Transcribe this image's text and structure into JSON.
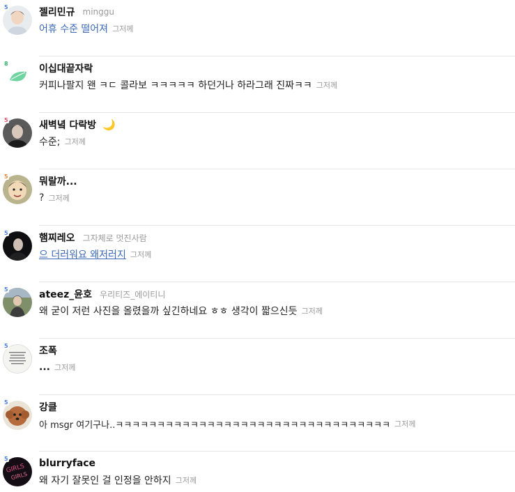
{
  "time_label": "그저께",
  "items": [
    {
      "badge": "5",
      "badge_color": "#4a7fe0",
      "name": "젤리민규",
      "subname": "minggu",
      "message": "어휴 수준 떨어져",
      "message_style": "blue",
      "avatar": "person-light"
    },
    {
      "badge": "8",
      "badge_color": "#2fb36b",
      "name": "이십대끝자락",
      "subname": "",
      "message": "커피나팔지 왠 ㅋㄷ 콜라보 ㅋㅋㅋㅋㅋ 하던거나 하라그래 진짜ㅋㅋ",
      "message_style": "normal",
      "avatar": "leaf"
    },
    {
      "badge": "5",
      "badge_color": "#e0506b",
      "name": "새벽녘 다락방",
      "subname": "",
      "message": "수준;",
      "message_style": "normal",
      "avatar": "person-dark",
      "moon": "🌙"
    },
    {
      "badge": "5",
      "badge_color": "#e08a3b",
      "name": "뭐랄까...",
      "subname": "",
      "message": "?",
      "message_style": "normal",
      "avatar": "child"
    },
    {
      "badge": "5",
      "badge_color": "#4a7fe0",
      "name": "햄찌레오",
      "subname": "그자체로 멋진사람",
      "message": "으 더러워요 왜저러지",
      "message_style": "link",
      "avatar": "person-black"
    },
    {
      "badge": "5",
      "badge_color": "#4a7fe0",
      "name": "ateez_윤호",
      "subname": "우리티즈_에이티니",
      "message": "왜 굳이 저런 사진을 올렸을까 싶긴하네요 ㅎㅎ 생각이 짧으신듯",
      "message_style": "normal",
      "avatar": "person-outdoor"
    },
    {
      "badge": "5",
      "badge_color": "#4a7fe0",
      "name": "조폭",
      "subname": "",
      "message": "...",
      "message_style": "normal",
      "avatar": "text-image"
    },
    {
      "badge": "5",
      "badge_color": "#4a7fe0",
      "name": "강클",
      "subname": "",
      "message": "아 msgr 여기구나..ㅋㅋㅋㅋㅋㅋㅋㅋㅋㅋㅋㅋㅋㅋㅋㅋㅋㅋㅋㅋㅋㅋㅋㅋㅋㅋㅋㅋㅋㅋㅋㅋㅋ",
      "message_style": "normal",
      "avatar": "dog"
    },
    {
      "badge": "5",
      "badge_color": "#4a7fe0",
      "name": "blurryface",
      "subname": "",
      "message": "왜 자기 잘못인 걸 인정을 안하지",
      "message_style": "normal",
      "avatar": "neon"
    }
  ]
}
